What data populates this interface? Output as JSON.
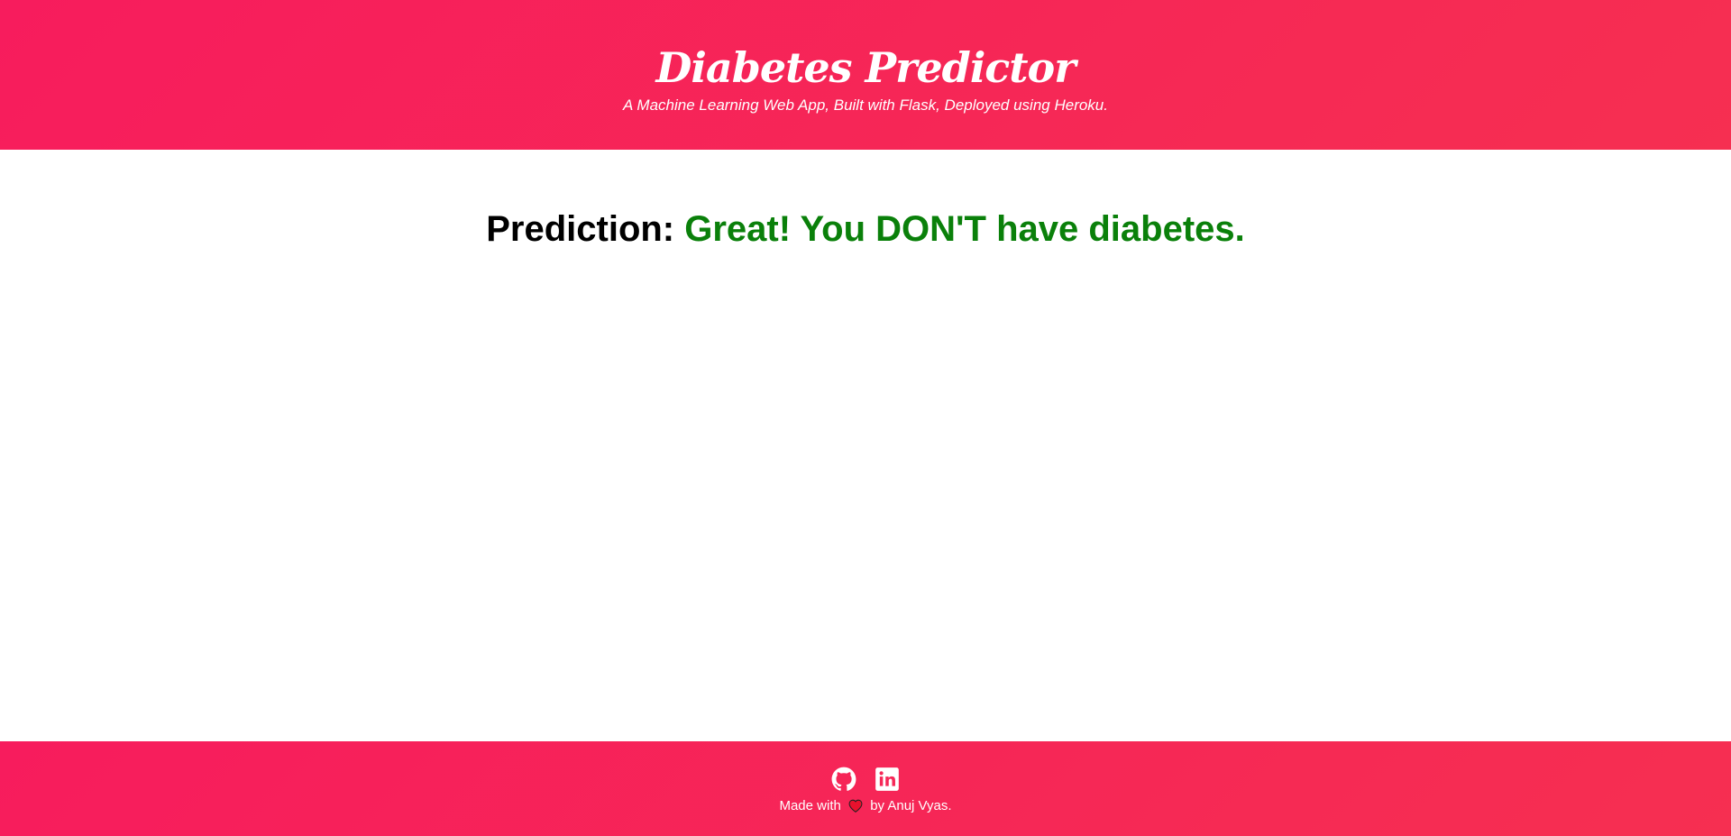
{
  "header": {
    "title": "Diabetes Predictor",
    "subtitle": "A Machine Learning Web App, Built with Flask, Deployed using Heroku."
  },
  "main": {
    "prediction_label": "Prediction:",
    "prediction_result": "Great! You DON'T have diabetes."
  },
  "footer": {
    "social_icons": [
      "github-icon",
      "linkedin-icon"
    ],
    "credit_before": "Made with",
    "credit_icon": "heart-icon",
    "credit_after": "by Anuj Vyas."
  },
  "colors": {
    "header_start": "#f71c5d",
    "header_end": "#f62f51",
    "result_green": "#0a800a",
    "heart_red": "#e8112d"
  }
}
